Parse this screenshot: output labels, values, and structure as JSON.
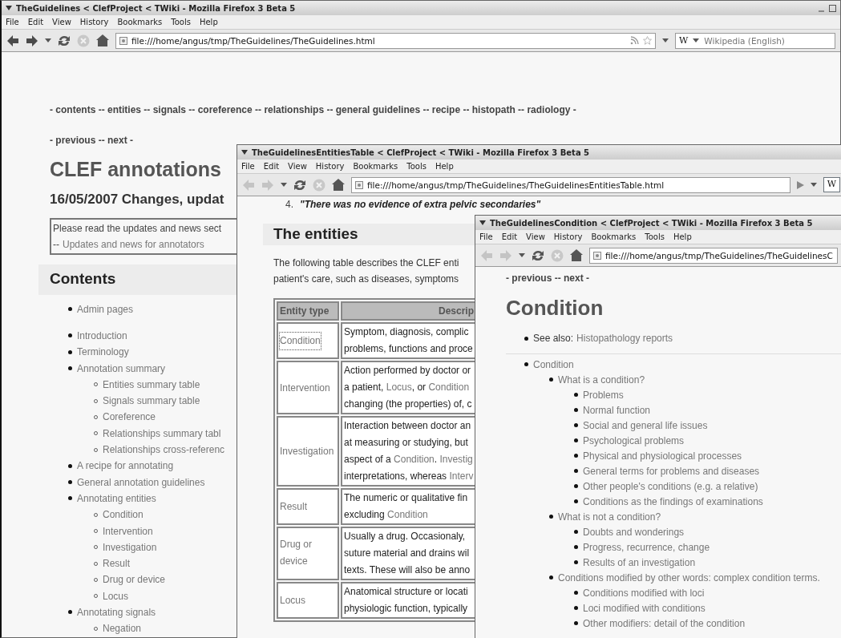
{
  "main_window": {
    "title": "TheGuidelines < ClefProject < TWiki - Mozilla Firefox 3 Beta 5",
    "menu": [
      "File",
      "Edit",
      "View",
      "History",
      "Bookmarks",
      "Tools",
      "Help"
    ],
    "toolbar": {
      "back_enabled": true,
      "forward_enabled": true,
      "url": "file:///home/angus/tmp/TheGuidelines/TheGuidelines.html",
      "search_engine": "W",
      "search_placeholder": "Wikipedia (English)"
    },
    "nav_links": "- contents -- entities -- signals -- coreference -- relationships -- general guidelines -- recipe -- histopath -- radiology -",
    "pager": "- previous -- next -",
    "heading": "CLEF annotations",
    "subheading": "16/05/2007 Changes, updat",
    "notice": {
      "text": "Please read the updates and news sect",
      "prefix": "--",
      "link": "Updates and news for annotators"
    },
    "contents": {
      "title": "Contents",
      "lists": [
        [
          {
            "label": "Admin pages"
          }
        ],
        [
          {
            "label": "Introduction"
          },
          {
            "label": "Terminology"
          },
          {
            "label": "Annotation summary",
            "children": [
              {
                "label": "Entities summary table"
              },
              {
                "label": "Signals summary table"
              },
              {
                "label": "Coreference"
              },
              {
                "label": "Relationships summary tabl"
              },
              {
                "label": "Relationships cross-referenc"
              }
            ]
          },
          {
            "label": "A recipe for annotating"
          },
          {
            "label": "General annotation guidelines"
          },
          {
            "label": "Annotating entities",
            "children": [
              {
                "label": "Condition"
              },
              {
                "label": "Intervention"
              },
              {
                "label": "Investigation"
              },
              {
                "label": "Result"
              },
              {
                "label": "Drug or device"
              },
              {
                "label": "Locus"
              }
            ]
          },
          {
            "label": "Annotating signals",
            "children": [
              {
                "label": "Negation"
              }
            ]
          }
        ]
      ]
    }
  },
  "entities_window": {
    "title": "TheGuidelinesEntitiesTable < ClefProject < TWiki - Mozilla Firefox 3 Beta 5",
    "menu": [
      "File",
      "Edit",
      "View",
      "History",
      "Bookmarks",
      "Tools",
      "Help"
    ],
    "toolbar": {
      "back_enabled": false,
      "forward_enabled": false,
      "url": "file:///home/angus/tmp/TheGuidelines/TheGuidelinesEntitiesTable.html",
      "search_engine": "W"
    },
    "list_item": {
      "number": "4.",
      "text": "\"There was no evidence of extra pelvic secondaries\""
    },
    "heading": "The entities",
    "intro_lines": [
      "The following table describes the CLEF enti",
      "patient's care, such as diseases, symptoms"
    ],
    "table": {
      "columns": [
        "Entity type",
        "Descrip"
      ],
      "rows": [
        {
          "type": "Condition",
          "focused": true,
          "description": [
            [
              {
                "text": "Symptom, diagnosis, complic",
                "link": false
              }
            ],
            [
              {
                "text": "problems, functions and proce",
                "link": false
              }
            ]
          ]
        },
        {
          "type": "Intervention",
          "focused": false,
          "description": [
            [
              {
                "text": "Action performed by doctor or",
                "link": false
              }
            ],
            [
              {
                "text": "a patient, ",
                "link": false
              },
              {
                "text": "Locus",
                "link": true
              },
              {
                "text": ", or ",
                "link": false
              },
              {
                "text": "Condition",
                "link": true
              }
            ],
            [
              {
                "text": "changing (the properties) of, c",
                "link": false
              }
            ]
          ]
        },
        {
          "type": "Investigation",
          "focused": false,
          "description": [
            [
              {
                "text": "Interaction between doctor an",
                "link": false
              }
            ],
            [
              {
                "text": "at measuring or studying, but",
                "link": false
              }
            ],
            [
              {
                "text": "aspect of a ",
                "link": false
              },
              {
                "text": "Condition",
                "link": true
              },
              {
                "text": ". ",
                "link": false
              },
              {
                "text": "Investig",
                "link": true
              }
            ],
            [
              {
                "text": "interpretations, whereas ",
                "link": false
              },
              {
                "text": "Interv",
                "link": true
              }
            ]
          ]
        },
        {
          "type": "Result",
          "focused": false,
          "description": [
            [
              {
                "text": "The numeric or qualitative fin",
                "link": false
              }
            ],
            [
              {
                "text": "excluding ",
                "link": false
              },
              {
                "text": "Condition",
                "link": true
              }
            ]
          ]
        },
        {
          "type": "Drug or device",
          "focused": false,
          "description": [
            [
              {
                "text": "Usually a drug. Occasionaly,",
                "link": false
              }
            ],
            [
              {
                "text": "suture material and drains wil",
                "link": false
              }
            ],
            [
              {
                "text": "texts. These will also be anno",
                "link": false
              }
            ]
          ]
        },
        {
          "type": "Locus",
          "focused": false,
          "description": [
            [
              {
                "text": "Anatomical structure or locati",
                "link": false
              }
            ],
            [
              {
                "text": "physiologic function, typically",
                "link": false
              }
            ]
          ]
        }
      ]
    }
  },
  "condition_window": {
    "title": "TheGuidelinesCondition < ClefProject < TWiki - Mozilla Firefox 3 Beta 5",
    "menu": [
      "File",
      "Edit",
      "View",
      "History",
      "Bookmarks",
      "Tools",
      "Help"
    ],
    "toolbar": {
      "back_enabled": false,
      "forward_enabled": false,
      "url": "file:///home/angus/tmp/TheGuidelines/TheGuidelinesC"
    },
    "pager": "- previous -- next -",
    "heading": "Condition",
    "see_also": {
      "label": "See also:",
      "link": "Histopathology reports"
    },
    "outline": [
      {
        "label": "Condition",
        "children": [
          {
            "label": "What is a condition?",
            "children": [
              {
                "label": "Problems"
              },
              {
                "label": "Normal function"
              },
              {
                "label": "Social and general life issues"
              },
              {
                "label": "Psychological problems"
              },
              {
                "label": "Physical and physiological processes"
              },
              {
                "label": "General terms for problems and diseases"
              },
              {
                "label": "Other people's conditions (e.g. a relative)"
              },
              {
                "label": "Conditions as the findings of examinations"
              }
            ]
          },
          {
            "label": "What is not a condition?",
            "children": [
              {
                "label": "Doubts and wonderings"
              },
              {
                "label": "Progress, recurrence, change"
              },
              {
                "label": "Results of an investigation"
              }
            ]
          },
          {
            "label": "Conditions modified by other words: complex condition terms.",
            "children": [
              {
                "label": "Conditions modified with loci"
              },
              {
                "label": "Loci modified with conditions"
              },
              {
                "label": "Other modifiers: detail of the condition"
              }
            ]
          }
        ]
      }
    ]
  }
}
